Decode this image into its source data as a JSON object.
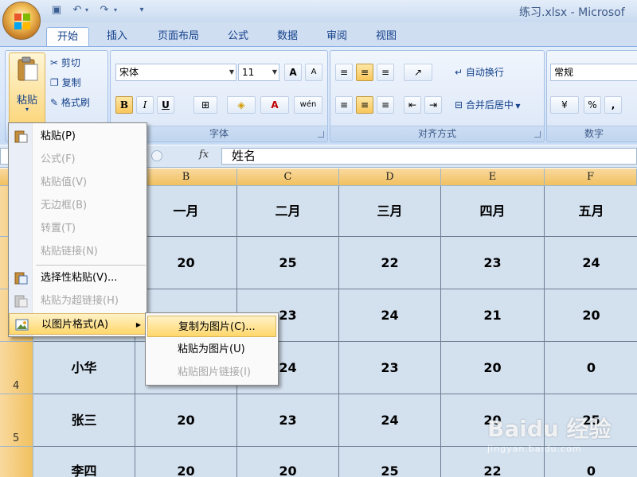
{
  "window": {
    "title": "练习.xlsx - Microsof"
  },
  "tabs": [
    "开始",
    "插入",
    "页面布局",
    "公式",
    "数据",
    "审阅",
    "视图"
  ],
  "clipboard": {
    "paste_label": "粘贴",
    "cut_label": "剪切",
    "copy_label": "复制",
    "format_painter_label": "格式刷"
  },
  "font": {
    "group_label": "字体",
    "font_name": "宋体",
    "font_size": "11",
    "bold": "B",
    "italic": "I",
    "underline": "U",
    "grow": "A",
    "shrink": "A",
    "font_color": "A",
    "phonetic": "wén"
  },
  "alignment": {
    "group_label": "对齐方式",
    "wrap_text_label": "自动换行",
    "merge_center_label": "合并后居中"
  },
  "number": {
    "group_label": "数字",
    "format_value": "常规",
    "percent": "%",
    "comma": ","
  },
  "formula_bar": {
    "fx_label": "fx",
    "content": "姓名"
  },
  "grid": {
    "columns": [
      "B",
      "C",
      "D",
      "E",
      "F"
    ],
    "row_numbers": [
      "",
      "",
      "",
      "4",
      "5",
      ""
    ],
    "rows": [
      [
        "一月",
        "二月",
        "三月",
        "四月",
        "五月"
      ],
      [
        "20",
        "25",
        "22",
        "23",
        "24"
      ],
      [
        "",
        "23",
        "24",
        "21",
        "20"
      ],
      [
        "",
        "24",
        "23",
        "20",
        "0"
      ],
      [
        "20",
        "23",
        "24",
        "20",
        "25"
      ],
      [
        "20",
        "20",
        "25",
        "22",
        "0"
      ]
    ],
    "names": [
      "",
      "",
      "",
      "小华",
      "张三",
      "李四"
    ]
  },
  "context_menu": {
    "items": [
      {
        "label": "粘贴(P)",
        "enabled": true
      },
      {
        "label": "公式(F)",
        "enabled": false
      },
      {
        "label": "粘贴值(V)",
        "enabled": false
      },
      {
        "label": "无边框(B)",
        "enabled": false
      },
      {
        "label": "转置(T)",
        "enabled": false
      },
      {
        "label": "粘贴链接(N)",
        "enabled": false
      },
      {
        "label": "选择性粘贴(V)...",
        "enabled": true
      },
      {
        "label": "粘贴为超链接(H)",
        "enabled": false
      },
      {
        "label": "以图片格式(A)",
        "enabled": true
      }
    ]
  },
  "submenu": {
    "items": [
      {
        "label": "复制为图片(C)...",
        "enabled": true
      },
      {
        "label": "粘贴为图片(U)",
        "enabled": true
      },
      {
        "label": "粘贴图片链接(I)",
        "enabled": false
      }
    ]
  },
  "watermark": {
    "logo": "Baidu 经验",
    "url": "jingyan.baidu.com"
  },
  "colors": {
    "accent": "#15428b",
    "header_orange": "#f1c15f",
    "cell_bg": "#d3e0ee",
    "highlight": "#ffd76b"
  }
}
